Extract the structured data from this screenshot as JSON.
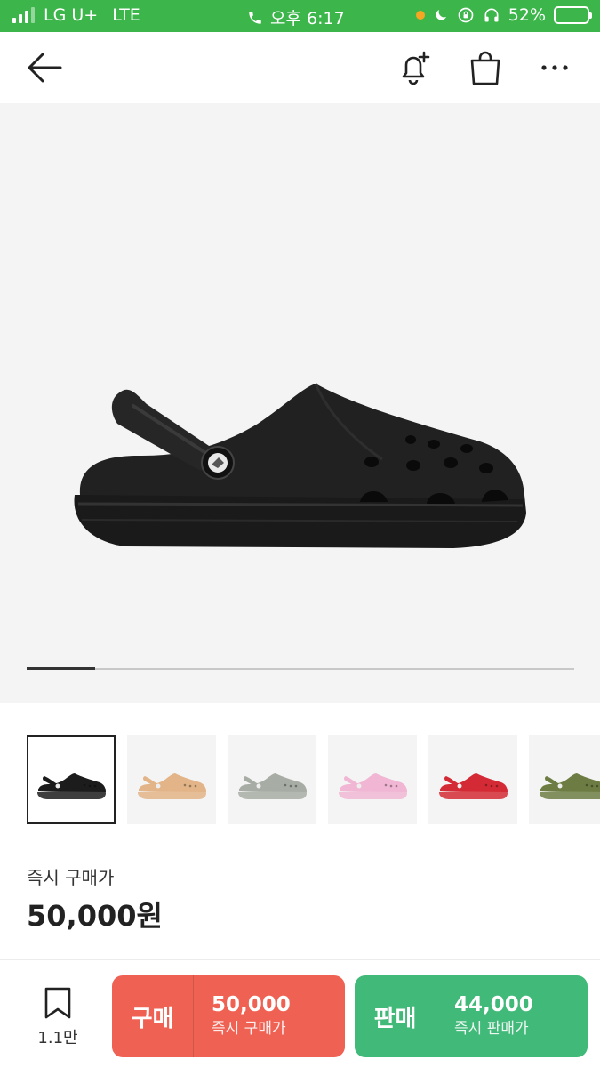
{
  "status_bar": {
    "carrier": "LG U+",
    "network": "LTE",
    "time": "오후 6:17",
    "battery": "52%"
  },
  "header": {
    "back_icon": "arrow-left-icon",
    "alert_icon": "bell-plus-icon",
    "bag_icon": "shopping-bag-icon",
    "more_icon": "more-horizontal-icon"
  },
  "gallery": {
    "progress_fraction": 0.125
  },
  "color_options": [
    {
      "name": "black",
      "color": "#1c1c1c"
    },
    {
      "name": "beige",
      "color": "#e2b487"
    },
    {
      "name": "grey",
      "color": "#a7ada4"
    },
    {
      "name": "pink",
      "color": "#f0b6d3"
    },
    {
      "name": "red",
      "color": "#d42a35"
    },
    {
      "name": "olive",
      "color": "#6d7c43"
    }
  ],
  "price": {
    "label": "즉시 구매가",
    "value": "50,000원"
  },
  "bottom_bar": {
    "wish_count": "1.1만",
    "buy": {
      "label": "구매",
      "amount": "50,000",
      "sub": "즉시 구매가",
      "color": "#ef6253"
    },
    "sell": {
      "label": "판매",
      "amount": "44,000",
      "sub": "즉시 판매가",
      "color": "#41b979"
    }
  },
  "colors": {
    "status_bar": "#3cb54a"
  }
}
